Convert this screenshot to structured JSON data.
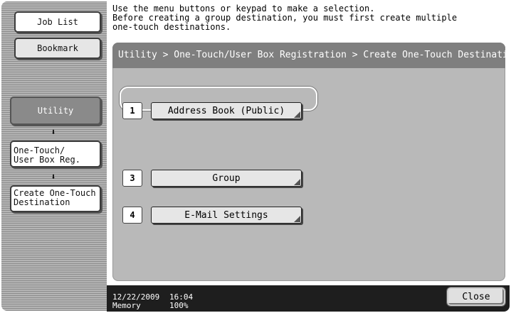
{
  "sidebar": {
    "job_list": "Job List",
    "bookmark": "Bookmark",
    "utility": "Utility",
    "arrow": "⬇",
    "onetouch": "One-Touch/\nUser Box Reg.",
    "create": "Create One-Touch\nDestination"
  },
  "message": "Use the menu buttons or keypad to make a selection.\nBefore creating a group destination, you must first create multiple\none-touch destinations.",
  "breadcrumb": "Utility > One-Touch/User Box Registration > Create One-Touch Destination",
  "destinations": [
    {
      "number": "1",
      "label": "Address Book (Public)",
      "selected": true
    },
    {
      "number": "3",
      "label": "Group",
      "selected": false
    },
    {
      "number": "4",
      "label": "E-Mail Settings",
      "selected": false
    }
  ],
  "status": {
    "date": "12/22/2009",
    "time": "16:04",
    "memory_label": "Memory",
    "memory_value": "100%",
    "close": "Close"
  },
  "colors": {
    "panel": "#b9b9b9",
    "breadcrumb_bar": "#7f7f7f",
    "status_bar": "#1e1e1e"
  }
}
